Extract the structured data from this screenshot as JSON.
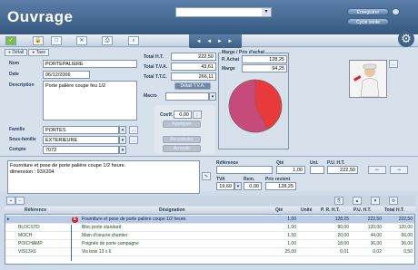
{
  "app": {
    "title": "Ouvrage",
    "top_select_value": "",
    "btn_enregistrer": "Enregistrer",
    "btn_cycle_vente": "Cycle vente"
  },
  "nav": {
    "arrows": "◄ ◄ ► ►"
  },
  "tabs": [
    {
      "label": "Détail"
    },
    {
      "label": "Taxe"
    }
  ],
  "form": {
    "nom_label": "Nom",
    "nom": "PORTEPALIERE",
    "date_label": "Date",
    "date": "06/12/2006",
    "description_label": "Description",
    "description": "Porte palière coupe feu 1/2",
    "famille_label": "Famille",
    "famille": "PORTES",
    "sous_famille_label": "Sous-famille",
    "sous_famille": "EXTERIEURE",
    "compte_label": "Compte",
    "compte": "7072"
  },
  "totals": {
    "ht_label": "Total H.T.",
    "ht": "222,50",
    "tva_label": "Total T.V.A.",
    "tva": "43,61",
    "ttc_label": "Total T.T.C.",
    "ttc": "266,11",
    "detail_tva": "Détail T.V.A.",
    "macro_label": "Macro",
    "coeff_label": "Coeff.",
    "coeff": "0,00",
    "btn_appliquer": "Appliquer",
    "btn_re_calculer": "Re-calculer",
    "btn_arrondir": "Arrondir"
  },
  "marge": {
    "title": "Marge / Prix d'achat",
    "achat_label": "P. Achat",
    "achat": "128,25",
    "marge_label": "Marge",
    "marge": "94,25",
    "pie_colors": {
      "achat": "#c64a7a",
      "marge": "#e83a3a"
    }
  },
  "designation_text": "Fourniture et pose de porte palière coupe 1/2 heure.\ndimension : 93X204",
  "line_edit": {
    "reference_label": "Référence",
    "reference": "",
    "qte_label": "Qté",
    "qte": "1,00",
    "unite_label": "Uni.",
    "unite": "",
    "puht_label": "P.U. H.T.",
    "puht": "222,50",
    "tva_label": "TVA",
    "tva": "19,60",
    "rem_label": "Rem.",
    "rem": "0,00",
    "prix_revient_label": "Prix revient",
    "prix_revient": "128,25"
  },
  "grid": {
    "headers": [
      "Référence",
      "Désignation",
      "Qté",
      "Unité",
      "P. R. H.T.",
      "P.U. H.T.",
      "Total H.T."
    ],
    "rows": [
      {
        "ref": "",
        "des": "Fourniture et pose de porte palière coupe 1/2 heure.",
        "qte": "1,00",
        "unite": "",
        "prht": "128,25",
        "puht": "222,50",
        "total": "222,50",
        "selected": true
      },
      {
        "ref": "BLOCSTD",
        "des": "Bloc porte standard",
        "qte": "1,00",
        "unite": "",
        "prht": "80,00",
        "puht": "120,00",
        "total": "120,00",
        "selected": false
      },
      {
        "ref": "MOCH",
        "des": "Main d'oeuvre chantier",
        "qte": "1,50",
        "unite": "",
        "prht": "20,00",
        "puht": "44,00",
        "total": "66,00",
        "selected": false
      },
      {
        "ref": "POICHAMP",
        "des": "Poignée de porte campagne",
        "qte": "1,00",
        "unite": "",
        "prht": "18,00",
        "puht": "36,00",
        "total": "36,00",
        "selected": false
      },
      {
        "ref": "VIS13X6",
        "des": "Vis bois 13 x 6",
        "qte": "25,00",
        "unite": "",
        "prht": "0,01",
        "puht": "0,02",
        "total": "0,50",
        "selected": false
      }
    ]
  }
}
